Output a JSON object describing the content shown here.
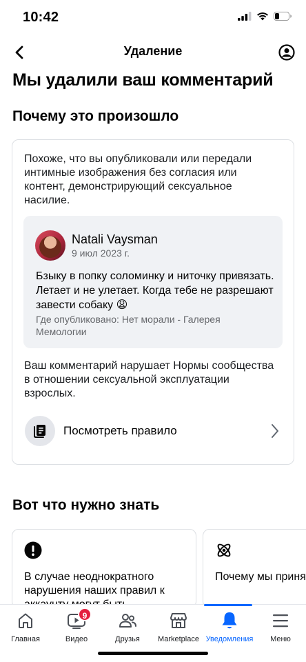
{
  "status_bar": {
    "time": "10:42",
    "icons": [
      "signal-icon",
      "wifi-icon",
      "battery-icon"
    ]
  },
  "header": {
    "title": "Удаление",
    "back_icon": "chevron-left-icon",
    "profile_icon": "profile-icon"
  },
  "page_title": "Мы удалили ваш комментарий",
  "why_section": {
    "title": "Почему это произошло",
    "reason": "Похоже, что вы опубликовали или передали интимные изображения без согласия или контент, демонстрирующий сексуальное насилие.",
    "quoted_comment": {
      "author": "Natali Vaysman",
      "date": "9 июл 2023 г.",
      "text": "Бзыку в попку соломинку и ниточку привязать. Летает и не улетает. Когда тебе не разрешают завести собаку 😩",
      "place": "Где опубликовано: Нет морали - Галерея Мемологии"
    },
    "violation": "Ваш комментарий нарушает Нормы сообщества в отношении сексуальной эксплуатации взрослых.",
    "rule_link": {
      "label": "Посмотреть правило",
      "icon": "book-icon",
      "chevron": "chevron-right-icon"
    }
  },
  "know_section": {
    "title": "Вот что нужно знать",
    "cards": [
      {
        "icon": "exclamation-icon",
        "text": "В случае неоднократного нарушения наших правил к аккаунту могут быть"
      },
      {
        "icon": "atom-icon",
        "text": "Почему мы приня решение"
      }
    ]
  },
  "bottom_nav": {
    "active": "notifications",
    "items": [
      {
        "key": "home",
        "label": "Главная",
        "icon": "home-icon"
      },
      {
        "key": "video",
        "label": "Видео",
        "icon": "video-icon",
        "badge": "9"
      },
      {
        "key": "friends",
        "label": "Друзья",
        "icon": "friends-icon"
      },
      {
        "key": "marketplace",
        "label": "Marketplace",
        "icon": "marketplace-icon"
      },
      {
        "key": "notifications",
        "label": "Уведомления",
        "icon": "bell-icon"
      },
      {
        "key": "menu",
        "label": "Меню",
        "icon": "menu-icon"
      }
    ]
  },
  "colors": {
    "accent": "#0866ff",
    "badge": "#e41e3f",
    "secondary_text": "#65676b",
    "card_border": "#dcdfe3",
    "quote_bg": "#f0f2f5"
  }
}
